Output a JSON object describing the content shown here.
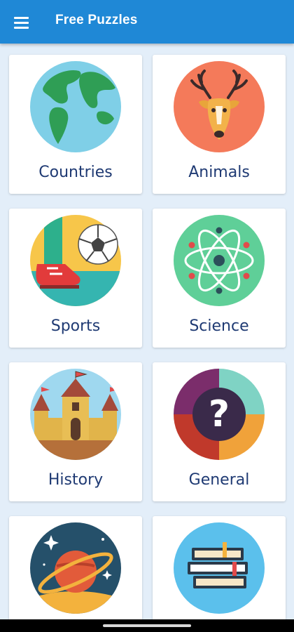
{
  "app_bar": {
    "title": "Free Puzzles",
    "menu_icon": "hamburger-menu-icon",
    "background_color": "#1f88d6"
  },
  "categories": [
    {
      "label": "Countries",
      "icon": "globe-icon"
    },
    {
      "label": "Animals",
      "icon": "deer-icon"
    },
    {
      "label": "Sports",
      "icon": "soccer-kick-icon"
    },
    {
      "label": "Science",
      "icon": "atom-icon"
    },
    {
      "label": "History",
      "icon": "castle-icon"
    },
    {
      "label": "General",
      "icon": "question-wheel-icon"
    },
    {
      "label": "",
      "icon": "planet-icon"
    },
    {
      "label": "",
      "icon": "books-icon"
    }
  ],
  "colors": {
    "label_text": "#1f3a73",
    "page_background": "#e3eef9"
  }
}
